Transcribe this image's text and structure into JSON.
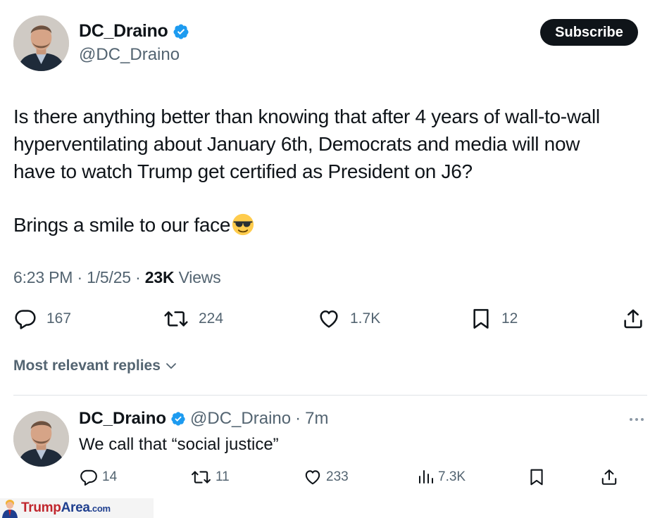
{
  "tweet": {
    "author_name": "DC_Draino",
    "author_handle": "@DC_Draino",
    "subscribe_label": "Subscribe",
    "text_lines": [
      "Is there anything better than knowing that after 4 years of wall-to-wall",
      "hyperventilating about January 6th, Democrats and media will now",
      "have to watch Trump get certified as President on J6?"
    ],
    "text_second_paragraph": "Brings a smile to our face",
    "time": "6:23 PM",
    "date": "1/5/25",
    "views_count": "23K",
    "views_label": "Views",
    "separator": "·",
    "stats": {
      "replies": "167",
      "reposts": "224",
      "likes": "1.7K",
      "bookmarks": "12"
    }
  },
  "replies_header": {
    "label": "Most relevant replies"
  },
  "reply": {
    "author_name": "DC_Draino",
    "author_handle": "@DC_Draino",
    "age": "7m",
    "separator": "·",
    "text": "We call that “social justice”",
    "stats": {
      "replies": "14",
      "reposts": "11",
      "likes": "233",
      "views": "7.3K"
    }
  },
  "watermark": {
    "part1": "Trump",
    "part2": "Area",
    "part3": ".com"
  },
  "colors": {
    "text_primary": "#0f1419",
    "text_secondary": "#536471",
    "verified_blue": "#1d9bf0",
    "button_bg": "#0f1419",
    "divider": "#dfe3e6",
    "watermark_red": "#c0262d",
    "watermark_blue": "#1f3f8f"
  },
  "icons": {
    "verified": "verified-badge-icon",
    "emoji": "smiling-face-with-sunglasses-emoji",
    "reply": "speech-bubble-icon",
    "repost": "repost-arrows-icon",
    "like": "heart-icon",
    "bookmark": "bookmark-icon",
    "share": "share-upload-icon",
    "views": "bar-chart-icon",
    "more": "ellipsis-icon",
    "chevron": "chevron-down-icon"
  }
}
